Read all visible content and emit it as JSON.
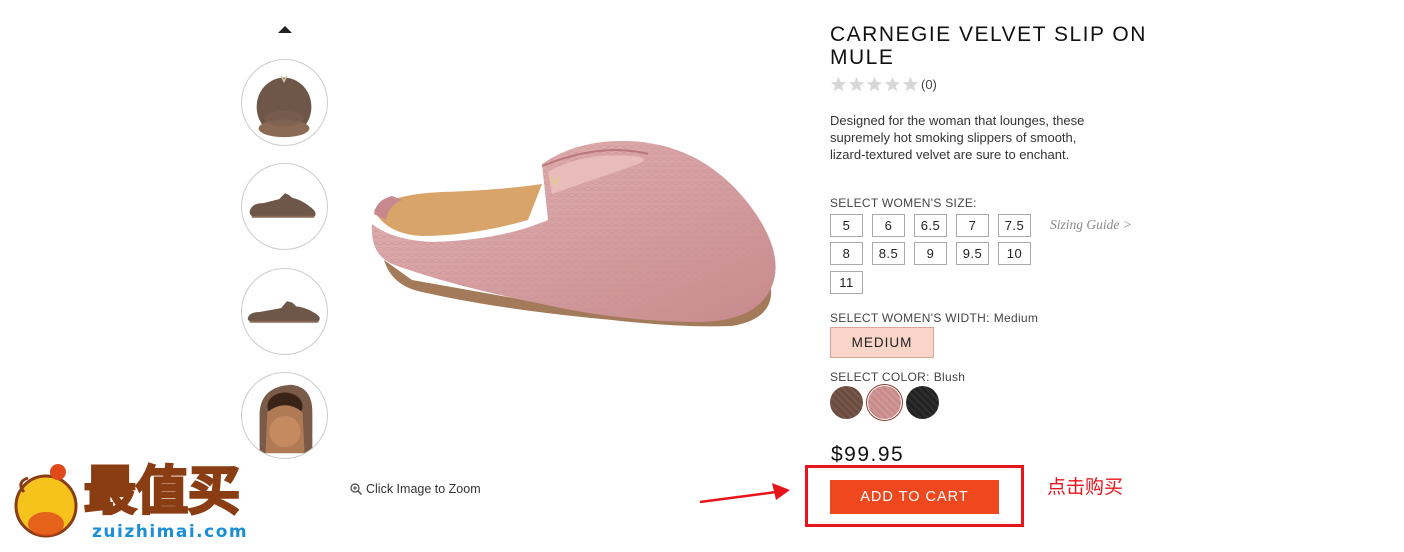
{
  "product": {
    "title": "CARNEGIE VELVET SLIP ON MULE",
    "rating_count": "(0)",
    "rating_stars": 0,
    "description": "Designed for the woman that lounges, these supremely hot smoking slippers of smooth, lizard-textured velvet are sure to enchant.",
    "price": "$99.95"
  },
  "gallery": {
    "zoom_hint": "Click Image to Zoom",
    "thumbnails": [
      "top view",
      "side view",
      "side view flat",
      "back view"
    ]
  },
  "size": {
    "label": "SELECT WOMEN'S SIZE:",
    "options": [
      "5",
      "6",
      "6.5",
      "7",
      "7.5",
      "8",
      "8.5",
      "9",
      "9.5",
      "10",
      "11"
    ],
    "sizing_guide": "Sizing Guide >"
  },
  "width": {
    "label": "SELECT WOMEN'S WIDTH:",
    "value": "Medium",
    "option": "MEDIUM"
  },
  "color": {
    "label": "SELECT COLOR:",
    "value": "Blush",
    "swatches": [
      {
        "name": "brown-swatch",
        "hex": "#6b4b3e"
      },
      {
        "name": "blush-swatch",
        "hex": "#c98a8a"
      },
      {
        "name": "black-swatch",
        "hex": "#222222"
      }
    ]
  },
  "cart": {
    "button_label": "ADD TO CART",
    "annotation": "点击购买"
  },
  "watermark": {
    "logo_text": "最值买",
    "domain": "zuizhimai.com"
  },
  "colors": {
    "accent": "#f0481e",
    "annotation_red": "#e8141b",
    "width_selected_bg": "#f9d4c8"
  }
}
